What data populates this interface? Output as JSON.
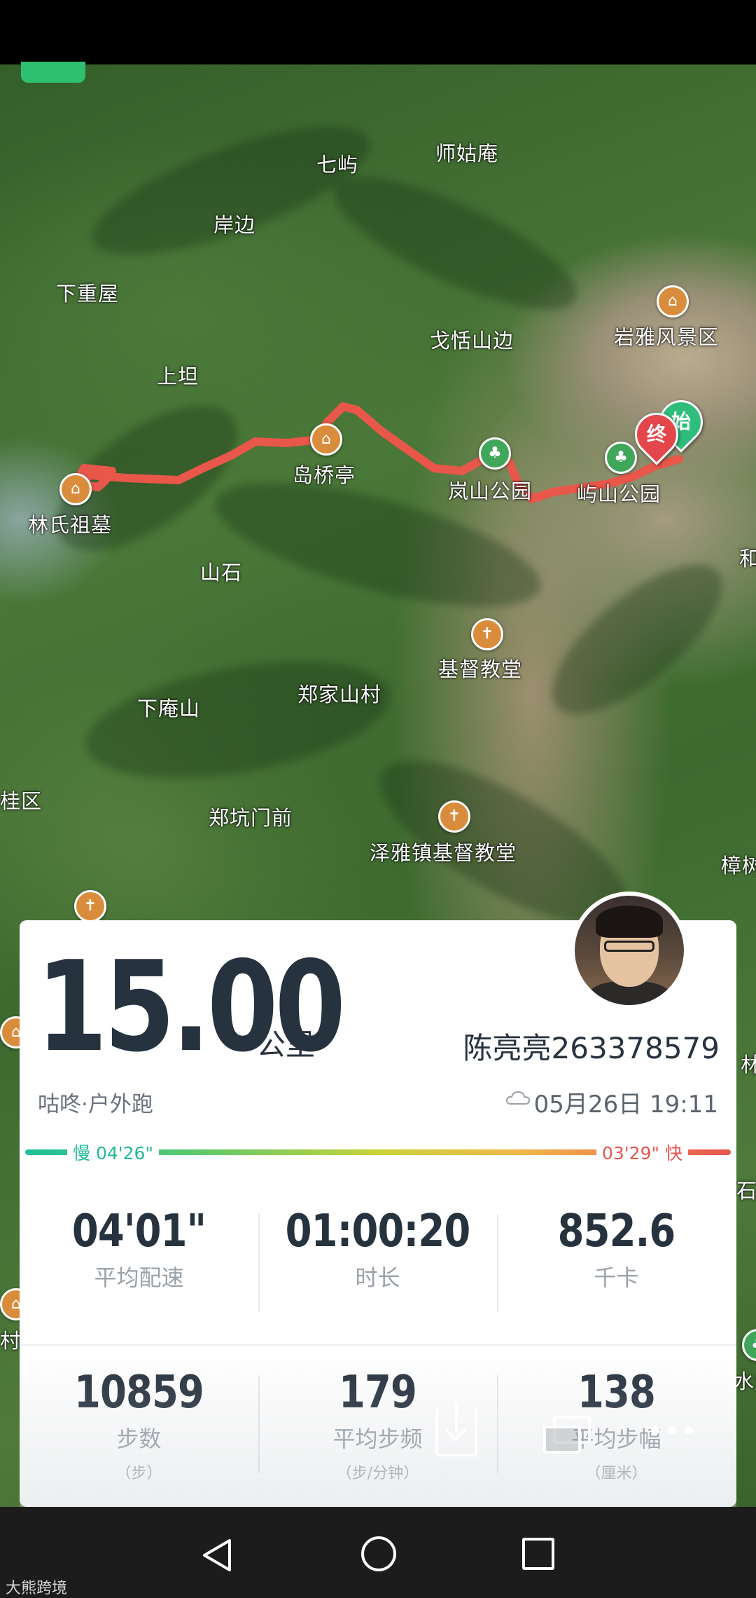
{
  "map": {
    "labels": [
      "七屿",
      "师姑庵",
      "岸边",
      "下重屋",
      "戈恬山边",
      "岩雅风景区",
      "上坦",
      "岛桥亭",
      "岚山公园",
      "屿山公园",
      "林氏祖墓",
      "山石",
      "基督教堂",
      "郑家山村",
      "下庵山",
      "郑坑门前",
      "泽雅镇基督教堂",
      "桂区",
      "樟树",
      "和",
      "林",
      "石",
      "水生",
      "村委"
    ],
    "start_marker": "始",
    "end_marker": "终",
    "route_color": "#e8574a"
  },
  "run": {
    "distance": "15.00",
    "unit": "公里",
    "user_name": "陈亮亮263378579",
    "app_activity": "咕咚·户外跑",
    "datetime": "05月26日 19:11"
  },
  "pace_scale": {
    "slow_label": "慢 04'26\"",
    "fast_label": "03'29\" 快",
    "slow_color": "#1fbf9c",
    "fast_color": "#e4574d"
  },
  "stats_row1": [
    {
      "value": "04'01\"",
      "label": "平均配速"
    },
    {
      "value": "01:00:20",
      "label": "时长"
    },
    {
      "value": "852.6",
      "label": "千卡"
    }
  ],
  "stats_row2": [
    {
      "value": "10859",
      "label": "步数",
      "unit": "（步）"
    },
    {
      "value": "179",
      "label": "平均步频",
      "unit": "（步/分钟）"
    },
    {
      "value": "138",
      "label": "平均步幅",
      "unit": "（厘米）"
    }
  ],
  "actions": [
    "download-icon",
    "share-icon",
    "more-icon"
  ],
  "navbar": [
    "back-icon",
    "home-icon",
    "recents-icon"
  ],
  "watermark": "大熊跨境"
}
